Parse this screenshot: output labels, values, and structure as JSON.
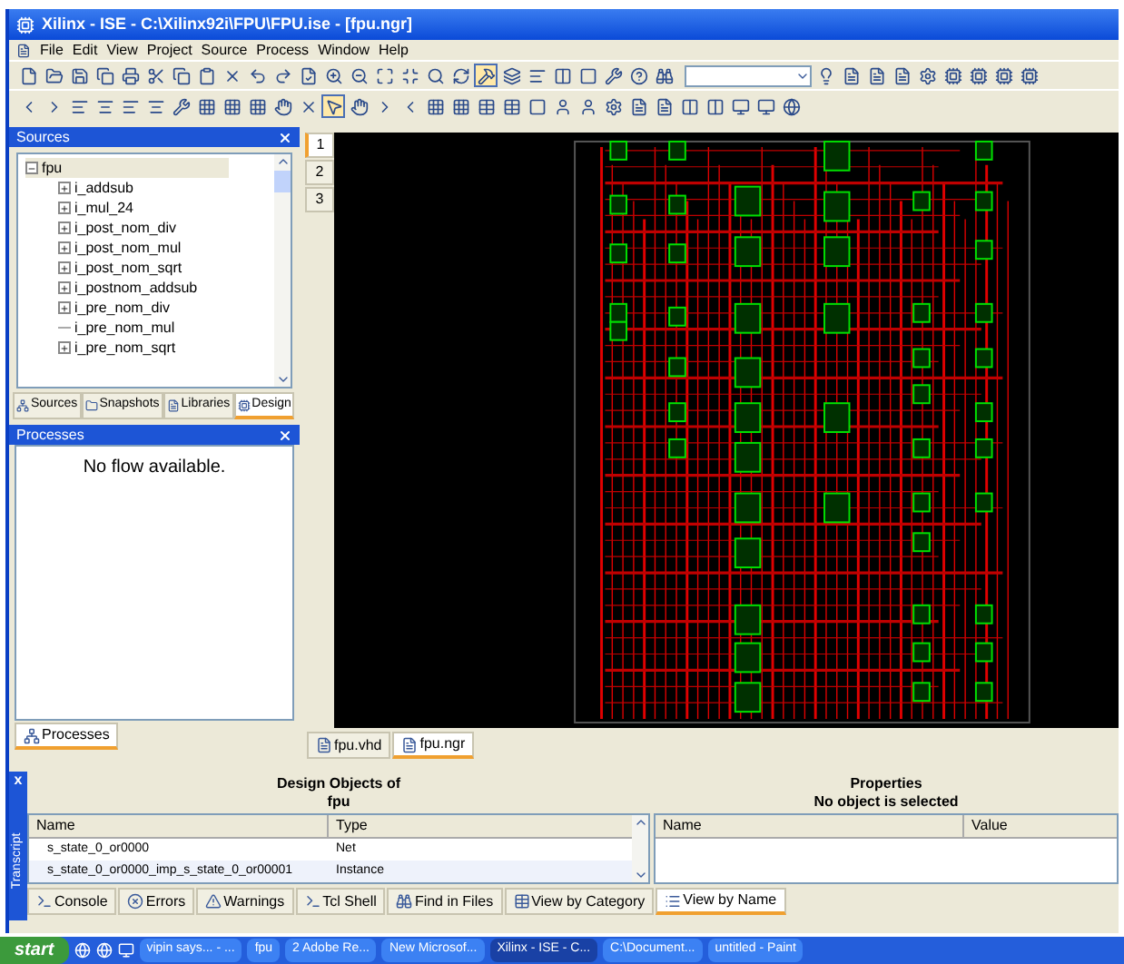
{
  "window": {
    "title": "Xilinx - ISE - C:\\Xilinx92i\\FPU\\FPU.ise - [fpu.ngr]"
  },
  "menu": [
    "File",
    "Edit",
    "View",
    "Project",
    "Source",
    "Process",
    "Window",
    "Help"
  ],
  "sources": {
    "title": "Sources",
    "tree": {
      "label": "fpu",
      "expanded": true,
      "children": [
        {
          "label": "i_addsub",
          "kind": "node"
        },
        {
          "label": "i_mul_24",
          "kind": "node"
        },
        {
          "label": "i_post_nom_div",
          "kind": "node"
        },
        {
          "label": "i_post_nom_mul",
          "kind": "node"
        },
        {
          "label": "i_post_nom_sqrt",
          "kind": "node"
        },
        {
          "label": "i_postnom_addsub",
          "kind": "node"
        },
        {
          "label": "i_pre_nom_div",
          "kind": "node"
        },
        {
          "label": "i_pre_nom_mul",
          "kind": "leaf"
        },
        {
          "label": "i_pre_nom_sqrt",
          "kind": "node"
        }
      ]
    },
    "tabs": [
      {
        "label": "Sources",
        "selected": false
      },
      {
        "label": "Snapshots",
        "selected": false
      },
      {
        "label": "Libraries",
        "selected": false
      },
      {
        "label": "Design",
        "selected": true
      }
    ]
  },
  "processes": {
    "title": "Processes",
    "message": "No flow available.",
    "tabs": [
      {
        "label": "Processes",
        "selected": true
      }
    ]
  },
  "page_tabs": [
    {
      "label": "1",
      "selected": true
    },
    {
      "label": "2",
      "selected": false
    },
    {
      "label": "3",
      "selected": false
    }
  ],
  "editor_tabs": [
    {
      "label": "fpu.vhd",
      "selected": false
    },
    {
      "label": "fpu.ngr",
      "selected": true
    }
  ],
  "transcript": {
    "label": "Transcript",
    "close": "x"
  },
  "design_objects": {
    "title": "Design Objects of",
    "subtitle": "fpu",
    "columns": [
      "Name",
      "Type"
    ],
    "rows": [
      {
        "name": "s_state_0_or0000",
        "type": "Net"
      },
      {
        "name": "s_state_0_or0000_imp_s_state_0_or00001",
        "type": "Instance"
      }
    ]
  },
  "properties": {
    "title": "Properties",
    "subtitle": "No object is selected",
    "columns": [
      "Name",
      "Value"
    ]
  },
  "bottom_tabs": [
    {
      "label": "Console",
      "selected": false
    },
    {
      "label": "Errors",
      "selected": false
    },
    {
      "label": "Warnings",
      "selected": false
    },
    {
      "label": "Tcl Shell",
      "selected": false
    },
    {
      "label": "Find in Files",
      "selected": false
    },
    {
      "label": "View by Category",
      "selected": false
    },
    {
      "label": "View by Name",
      "selected": true
    }
  ],
  "taskbar": {
    "start": "start",
    "items": [
      {
        "label": "vipin says... - ...",
        "selected": false
      },
      {
        "label": "fpu",
        "selected": false
      },
      {
        "label": "2 Adobe Re...",
        "selected": false
      },
      {
        "label": "New Microsof...",
        "selected": false
      },
      {
        "label": "Xilinx - ISE - C...",
        "selected": true
      },
      {
        "label": "C:\\Document...",
        "selected": false
      },
      {
        "label": "untitled - Paint",
        "selected": false
      }
    ]
  }
}
